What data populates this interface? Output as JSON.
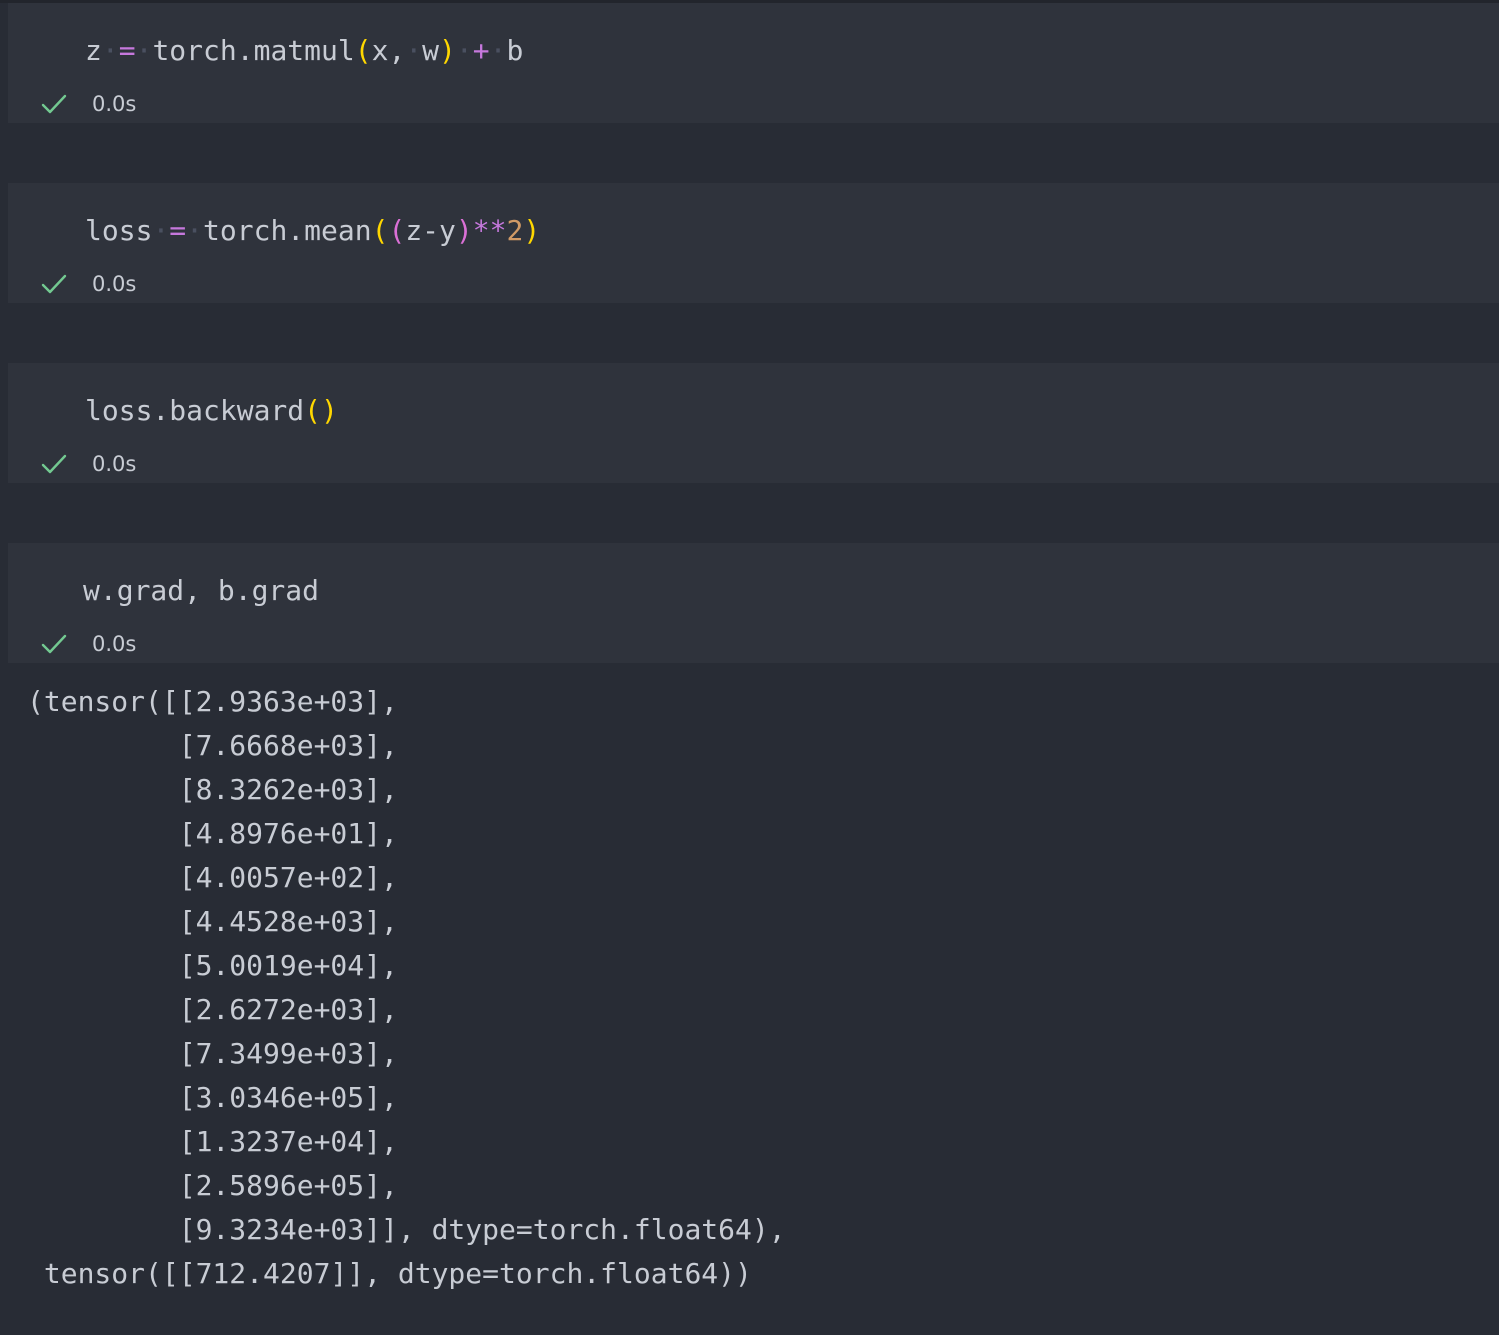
{
  "cells": [
    {
      "tokens": [
        "z",
        "=",
        "torch.matmul",
        "(",
        "x,",
        "w",
        ")",
        "+",
        "b"
      ],
      "status": "0.0s"
    },
    {
      "tokens": [
        "loss",
        "=",
        "torch.mean",
        "(",
        "(",
        "z-y",
        ")",
        "**",
        "2",
        ")"
      ],
      "status": "0.0s"
    },
    {
      "tokens": [
        "loss.backward",
        "()"
      ],
      "status": "0.0s"
    },
    {
      "tokens": [
        "w.grad, b.grad"
      ],
      "status": "0.0s"
    }
  ],
  "output": {
    "lines": [
      "(tensor([[2.9363e+03],",
      "         [7.6668e+03],",
      "         [8.3262e+03],",
      "         [4.8976e+01],",
      "         [4.0057e+02],",
      "         [4.4528e+03],",
      "         [5.0019e+04],",
      "         [2.6272e+03],",
      "         [7.3499e+03],",
      "         [3.0346e+05],",
      "         [1.3237e+04],",
      "         [2.5896e+05],",
      "         [9.3234e+03]], dtype=torch.float64),",
      " tensor([[712.4207]], dtype=torch.float64))"
    ]
  },
  "colors": {
    "background": "#282c35",
    "cell_background": "#2f333c",
    "text": "#c8ccd4",
    "operator": "#c678dd",
    "bracket_level1": "#ffd700",
    "bracket_level2": "#da70d6",
    "number": "#d19a66",
    "success_check": "#73c991"
  },
  "icons": {
    "status_icon": "check-icon"
  }
}
